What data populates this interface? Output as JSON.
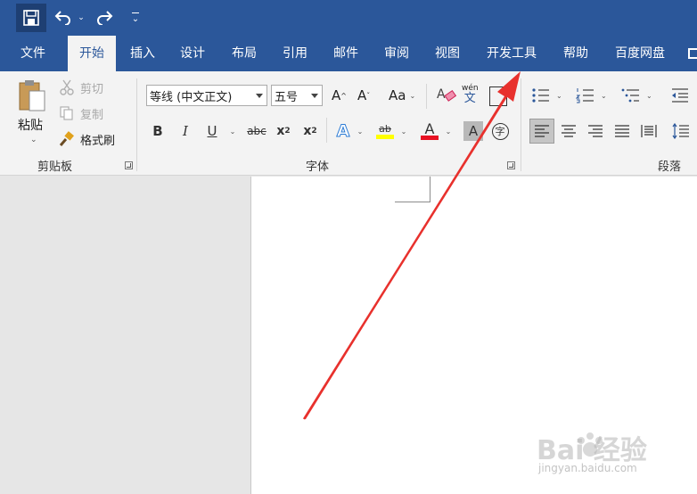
{
  "qat": {
    "undo_dropdown": "⌄",
    "customize": "⌄"
  },
  "tabs": [
    {
      "label": "文件"
    },
    {
      "label": "开始"
    },
    {
      "label": "插入"
    },
    {
      "label": "设计"
    },
    {
      "label": "布局"
    },
    {
      "label": "引用"
    },
    {
      "label": "邮件"
    },
    {
      "label": "审阅"
    },
    {
      "label": "视图"
    },
    {
      "label": "开发工具"
    },
    {
      "label": "帮助"
    },
    {
      "label": "百度网盘"
    }
  ],
  "clipboard": {
    "paste_label": "粘贴",
    "cut_label": "剪切",
    "copy_label": "复制",
    "format_painter_label": "格式刷",
    "group_label": "剪贴板"
  },
  "font": {
    "font_name": "等线 (中文正文)",
    "font_size": "五号",
    "grow_label": "A",
    "shrink_label": "A",
    "case_label": "Aa",
    "phonetic_top": "wén",
    "phonetic_bottom": "文",
    "bold": "B",
    "italic": "I",
    "underline": "U",
    "strike": "abc",
    "subscript": "x",
    "subscript_mark": "2",
    "superscript": "x",
    "superscript_mark": "2",
    "effects": "A",
    "highlight": "ab",
    "font_color": "A",
    "shading": "A",
    "enclose": "字",
    "group_label": "字体"
  },
  "paragraph": {
    "group_label": "段落"
  },
  "colors": {
    "title_bar": "#2b579a",
    "highlight": "#ffff00",
    "font_color": "#e81123",
    "arrow": "#e8312d"
  },
  "watermark": {
    "main": "Bai 经验",
    "sub": "jingyan.baidu.com"
  }
}
